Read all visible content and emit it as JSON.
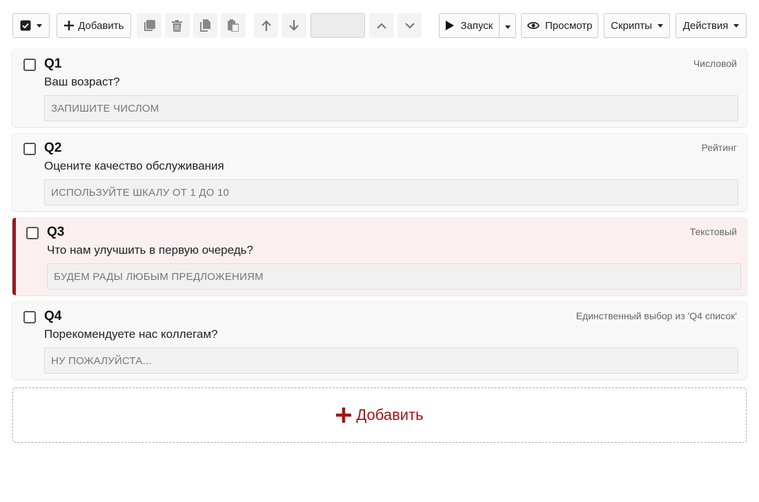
{
  "toolbar": {
    "add_label": "Добавить",
    "run_label": "Запуск",
    "preview_label": "Просмотр",
    "scripts_label": "Скрипты",
    "actions_label": "Действия"
  },
  "questions": [
    {
      "id": "Q1",
      "type": "Числовой",
      "text": "Ваш возраст?",
      "placeholder": "ЗАПИШИТЕ ЧИСЛОМ"
    },
    {
      "id": "Q2",
      "type": "Рейтинг",
      "text": "Оцените качество обслуживания",
      "placeholder": "ИСПОЛЬЗУЙТЕ ШКАЛУ ОТ 1 ДО 10"
    },
    {
      "id": "Q3",
      "type": "Текстовый",
      "text": "Что нам улучшить в первую очередь?",
      "placeholder": "БУДЕМ РАДЫ ЛЮБЫМ ПРЕДЛОЖЕНИЯМ"
    },
    {
      "id": "Q4",
      "type": "Единственный выбор из 'Q4 список'",
      "text": "Порекомендуете нас коллегам?",
      "placeholder": "НУ ПОЖАЛУЙСТА..."
    }
  ],
  "add_zone": {
    "label": "Добавить"
  },
  "colors": {
    "accent": "#a01616",
    "active_bg": "#fbefef"
  },
  "icons": [
    "checkbox-icon",
    "plus-icon",
    "copy-icon",
    "trash-icon",
    "duplicate-icon",
    "paste-icon",
    "arrow-up-icon",
    "arrow-down-icon",
    "chevron-up-icon",
    "chevron-down-icon",
    "play-icon",
    "eye-icon",
    "caret-down-icon"
  ]
}
